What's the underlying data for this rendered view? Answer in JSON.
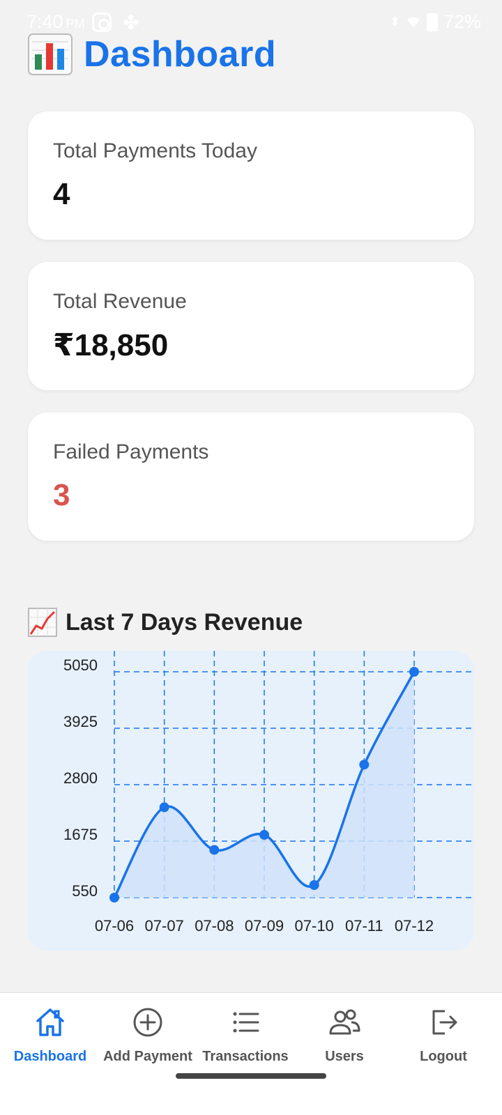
{
  "status_bar": {
    "time": "7:40",
    "ampm": "PM",
    "battery": "72%"
  },
  "header": {
    "title": "Dashboard",
    "icon": "bar-chart-icon"
  },
  "cards": [
    {
      "label": "Total Payments Today",
      "value": "4"
    },
    {
      "label": "Total Revenue",
      "value": "₹18,850"
    },
    {
      "label": "Failed Payments",
      "value": "3",
      "color": "#d9534f"
    }
  ],
  "chart_section": {
    "title": "Last 7 Days Revenue",
    "icon": "trending-up-icon"
  },
  "chart_data": {
    "type": "area",
    "title": "Last 7 Days Revenue",
    "categories": [
      "07-06",
      "07-07",
      "07-08",
      "07-09",
      "07-10",
      "07-11",
      "07-12"
    ],
    "values": [
      550,
      2350,
      1500,
      1800,
      800,
      3200,
      5050
    ],
    "yticks": [
      550,
      1675,
      2800,
      3925,
      5050
    ],
    "ylim": [
      550,
      5050
    ],
    "grid": true,
    "line_color": "#1a73e8",
    "fill_color": "#cfe2fa"
  },
  "bottom_nav": {
    "items": [
      {
        "label": "Dashboard",
        "icon": "home-icon",
        "active": true
      },
      {
        "label": "Add Payment",
        "icon": "plus-circle-icon",
        "active": false
      },
      {
        "label": "Transactions",
        "icon": "list-icon",
        "active": false
      },
      {
        "label": "Users",
        "icon": "users-icon",
        "active": false
      },
      {
        "label": "Logout",
        "icon": "logout-icon",
        "active": false
      }
    ]
  },
  "colors": {
    "accent": "#1a73e8",
    "background": "#f2f2f2",
    "failed": "#d9534f"
  }
}
